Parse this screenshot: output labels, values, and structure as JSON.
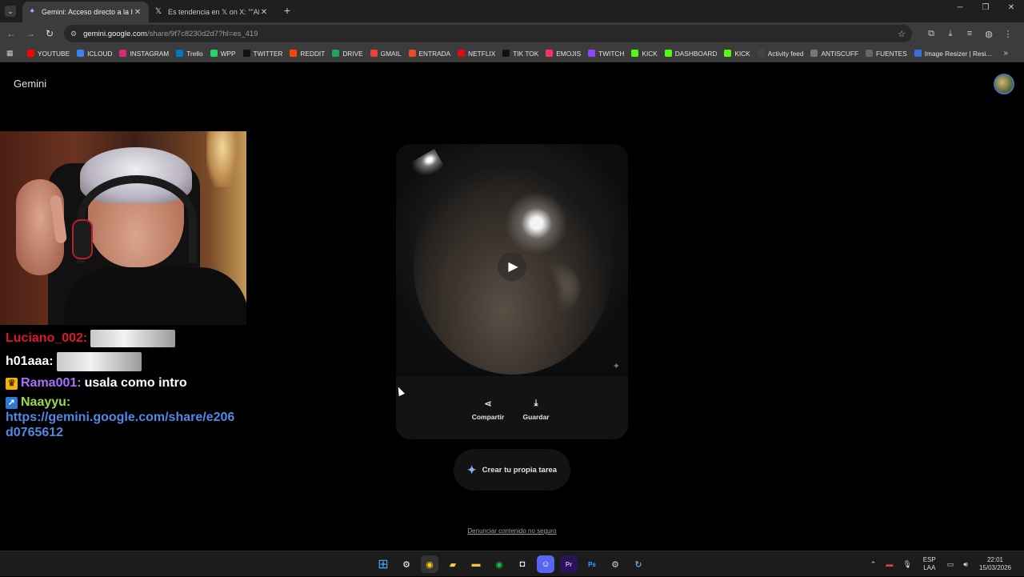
{
  "browser": {
    "tabs": [
      {
        "title": "Gemini: Acceso directo a la IA d",
        "active": true,
        "icon": "gemini-icon"
      },
      {
        "title": "Es tendencia en 𝕏 on X: \"\"Abue",
        "active": false,
        "icon": "x-icon"
      }
    ],
    "url_host": "gemini.google.com",
    "url_path": "/share/9f7c8230d2d7?hl=es_419",
    "bookmarks": [
      {
        "label": "YOUTUBE",
        "color": "#ff0000",
        "icon": "youtube-icon"
      },
      {
        "label": "ICLOUD",
        "color": "#3b82f6",
        "icon": "cloud-icon"
      },
      {
        "label": "INSTAGRAM",
        "color": "#d62976",
        "icon": "instagram-icon"
      },
      {
        "label": "Trello",
        "color": "#0079bf",
        "icon": "trello-icon"
      },
      {
        "label": "WPP",
        "color": "#25d366",
        "icon": "whatsapp-icon"
      },
      {
        "label": "TWITTER",
        "color": "#111111",
        "icon": "x-icon"
      },
      {
        "label": "REDDIT",
        "color": "#ff4500",
        "icon": "reddit-icon"
      },
      {
        "label": "DRIVE",
        "color": "#1fa463",
        "icon": "drive-icon"
      },
      {
        "label": "GMAIL",
        "color": "#ea4335",
        "icon": "gmail-icon"
      },
      {
        "label": "ENTRADA",
        "color": "#e44d26",
        "icon": "link-icon"
      },
      {
        "label": "NETFLIX",
        "color": "#e50914",
        "icon": "netflix-icon"
      },
      {
        "label": "TIK TOK",
        "color": "#111111",
        "icon": "tiktok-icon"
      },
      {
        "label": "EMOJIS",
        "color": "#ff2e63",
        "icon": "emoji-icon"
      },
      {
        "label": "TWITCH",
        "color": "#9146ff",
        "icon": "twitch-icon"
      },
      {
        "label": "KICK",
        "color": "#53fc18",
        "icon": "kick-icon"
      },
      {
        "label": "DASHBOARD",
        "color": "#53fc18",
        "icon": "kick-icon"
      },
      {
        "label": "KICK",
        "color": "#53fc18",
        "icon": "kick-icon"
      },
      {
        "label": "Activity feed",
        "color": "#444444",
        "icon": "anchor-icon"
      },
      {
        "label": "ANTISCUFF",
        "color": "#777777",
        "icon": "bars-icon"
      },
      {
        "label": "FUENTES",
        "color": "#666666",
        "icon": "globe-icon"
      },
      {
        "label": "Image Resizer | Resi...",
        "color": "#3b6fd8",
        "icon": "resize-icon"
      }
    ]
  },
  "gemini": {
    "brand": "Gemini",
    "share_label": "Compartir",
    "save_label": "Guardar",
    "create_label": "Crear tu propia tarea",
    "report_label": "Denunciar contenido no seguro"
  },
  "stream_chat": [
    {
      "user": "Luciano_002:",
      "color": "#e0162b",
      "badge": "",
      "message": "",
      "emote": true
    },
    {
      "user": "h01aaa:",
      "color": "#ffffff",
      "badge": "",
      "message": "",
      "emote": true
    },
    {
      "user": "Rama001:",
      "color": "#a970ff",
      "badge": "crown",
      "message": "usala como intro",
      "emote": false
    },
    {
      "user": "Naayyu:",
      "color": "#9ad94a",
      "badge": "arrow",
      "message": "",
      "emote": false,
      "link": "https://gemini.google.com/share/e206d0765612"
    }
  ],
  "taskbar": {
    "lang_top": "ESP",
    "lang_bottom": "LAA",
    "time": "22:01",
    "date": "15/03/2026"
  }
}
